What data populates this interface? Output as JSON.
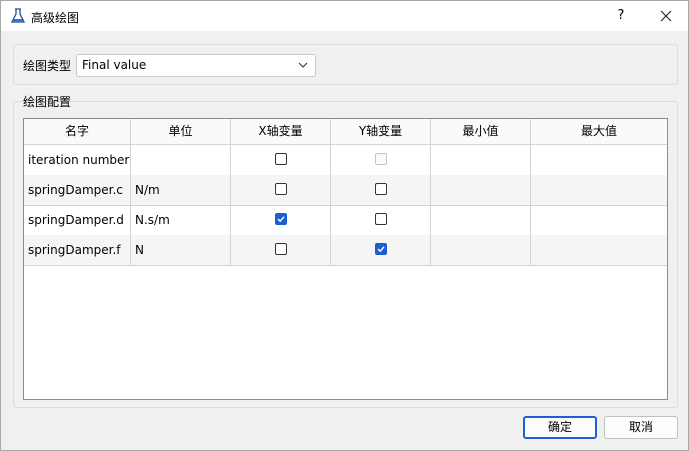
{
  "window": {
    "title": "高级绘图",
    "help_label": "?"
  },
  "plot_type": {
    "label": "绘图类型",
    "value": "Final value"
  },
  "plot_config": {
    "title": "绘图配置",
    "columns": [
      "名字",
      "单位",
      "X轴变量",
      "Y轴变量",
      "最小值",
      "最大值"
    ],
    "rows": [
      {
        "name": "iteration number",
        "unit": "",
        "x_axis": false,
        "y_axis": false,
        "y_disabled": true,
        "min": "",
        "max": ""
      },
      {
        "name": "springDamper.c",
        "unit": "N/m",
        "x_axis": false,
        "y_axis": false,
        "y_disabled": false,
        "min": "",
        "max": ""
      },
      {
        "name": "springDamper.d",
        "unit": "N.s/m",
        "x_axis": true,
        "y_axis": false,
        "y_disabled": false,
        "min": "",
        "max": ""
      },
      {
        "name": "springDamper.f",
        "unit": "N",
        "x_axis": false,
        "y_axis": true,
        "y_disabled": false,
        "min": "",
        "max": ""
      }
    ]
  },
  "buttons": {
    "ok": "确定",
    "cancel": "取消"
  },
  "colors": {
    "accent": "#1c5fd1"
  }
}
